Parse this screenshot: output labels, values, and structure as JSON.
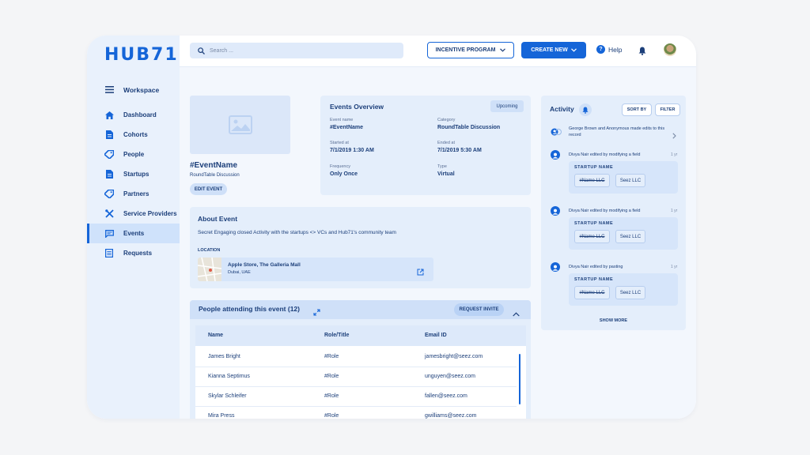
{
  "brand": {
    "logo": "HUB71",
    "accent": "#1565d8"
  },
  "sidebar": {
    "workspace": "Workspace",
    "items": [
      {
        "label": "Dashboard",
        "icon": "home-icon"
      },
      {
        "label": "Cohorts",
        "icon": "document-icon"
      },
      {
        "label": "People",
        "icon": "tag-icon"
      },
      {
        "label": "Startups",
        "icon": "document-icon"
      },
      {
        "label": "Partners",
        "icon": "tag-icon"
      },
      {
        "label": "Service Providers",
        "icon": "tools-icon"
      },
      {
        "label": "Events",
        "icon": "chat-icon",
        "active": true
      },
      {
        "label": "Requests",
        "icon": "list-icon"
      }
    ]
  },
  "topbar": {
    "search_placeholder": "Search ...",
    "incentive_program": "INCENTIVE PROGRAM",
    "create_new": "CREATE NEW",
    "help": "Help"
  },
  "event": {
    "title": "#EventName",
    "subtitle": "RoundTable Discussion",
    "edit_button": "EDIT EVENT"
  },
  "overview": {
    "title": "Events Overview",
    "status": "Upcoming",
    "fields": {
      "event_name_label": "Event name",
      "event_name": "#EventName",
      "category_label": "Category",
      "category": "RoundTable Discussion",
      "started_label": "Started at",
      "started": "7/1/2019  1:30 AM",
      "ended_label": "Ended at",
      "ended": "7/1/2019  5:30 AM",
      "frequency_label": "Frequency",
      "frequency": "Only Once",
      "type_label": "Type",
      "type": "Virtual"
    }
  },
  "about": {
    "title": "About Event",
    "description": "Secret Engaging closed Activity with the startups <> VCs and Hub71's community team",
    "location_label": "LOCATION",
    "location_name": "Apple Store, The Galleria Mall",
    "location_city": "Dubai, UAE"
  },
  "attendees": {
    "title": "People attending this event (12)",
    "request_invite": "REQUEST INVITE",
    "columns": [
      "Name",
      "Role/Title",
      "Email ID"
    ],
    "rows": [
      {
        "name": "James Bright",
        "role": "#Role",
        "email": "jamesbright@seez.com"
      },
      {
        "name": "Kianna Septimus",
        "role": "#Role",
        "email": "unguyen@seez.com"
      },
      {
        "name": "Skylar Schleifer",
        "role": "#Role",
        "email": "fallen@seez.com"
      },
      {
        "name": "Mira Press",
        "role": "#Role",
        "email": "gwilliams@seez.com"
      }
    ]
  },
  "activity": {
    "title": "Activity",
    "sort_by": "SORT BY",
    "filter": "FILTER",
    "summary": "George Brown and Anonymous made edits to this record",
    "items": [
      {
        "text": "Divya Nair edited by modifying a field",
        "time": "1 yr",
        "field": "STARTUP NAME",
        "old": "#Name LLC",
        "new": "Seez LLC"
      },
      {
        "text": "Divya Nair edited by modifying a field",
        "time": "1 yr",
        "field": "STARTUP NAME",
        "old": "#Name LLC",
        "new": "Seez LLC"
      },
      {
        "text": "Divya Nair edited by pasting",
        "time": "1 yr",
        "field": "STARTUP NAME",
        "old": "#Name LLC",
        "new": "Seez LLC"
      }
    ],
    "show_more": "SHOW MORE"
  }
}
